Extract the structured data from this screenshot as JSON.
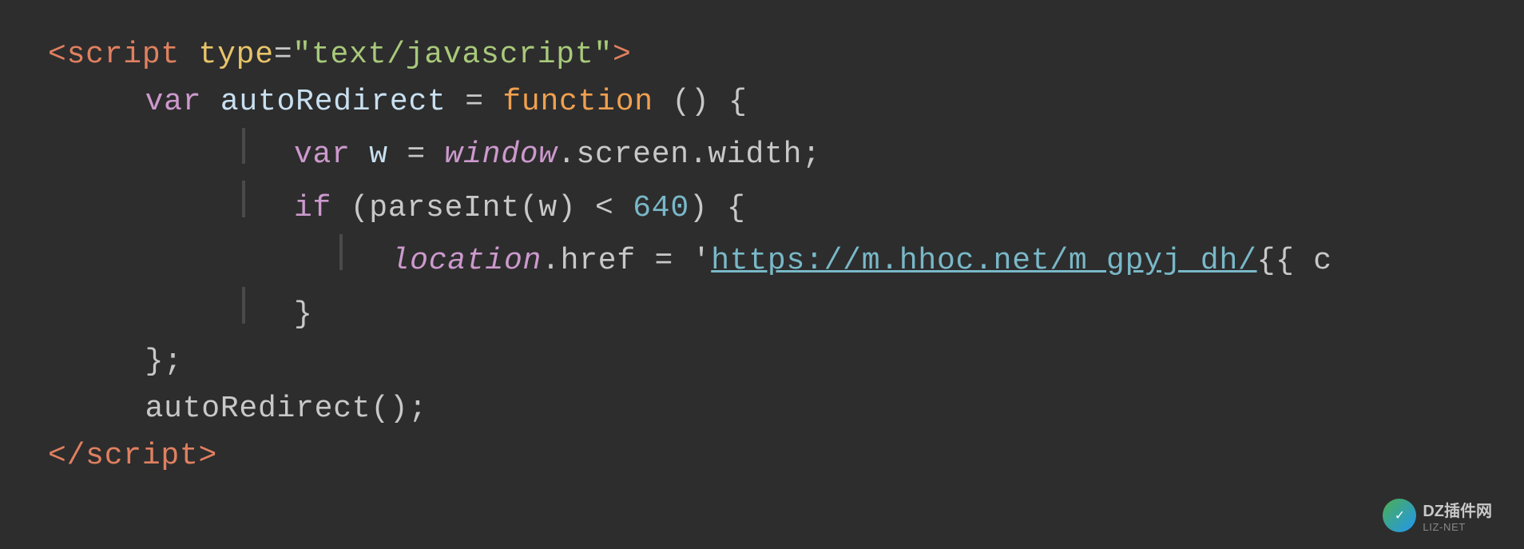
{
  "code": {
    "line1": {
      "open_bracket": "<",
      "tag": "script",
      "space": " ",
      "attr_name": "type",
      "equals": "=",
      "attr_value": "\"text/javascript\"",
      "close_bracket": ">"
    },
    "line2": {
      "keyword": "var",
      "varname": " autoRedirect ",
      "equals": "= ",
      "function_kw": "function",
      "rest": " () {"
    },
    "line3": {
      "keyword": "var",
      "varname": " w ",
      "equals": "= ",
      "object": "window",
      "property": ".screen.width;"
    },
    "line4": {
      "keyword": "if",
      "paren_open": " (",
      "method": "parseInt",
      "arg": "(w)",
      "operator": " < ",
      "number": "640",
      "rest": ") {"
    },
    "line5": {
      "object": "location",
      "property": ".href",
      "equals": " = ",
      "quote": "'",
      "url": "https://m.hhoc.net/m_gpyj_dh/",
      "template": "{{ c"
    },
    "line6": {
      "close": "}"
    },
    "line7": {
      "close": "};"
    },
    "line8": {
      "call": "autoRedirect();"
    },
    "line9": {
      "open_bracket": "</",
      "tag": "script",
      "close_bracket": ">"
    }
  },
  "watermark": {
    "icon_text": "✓",
    "main_text": "DZ插件网",
    "sub_text": "LIZ-NET"
  }
}
